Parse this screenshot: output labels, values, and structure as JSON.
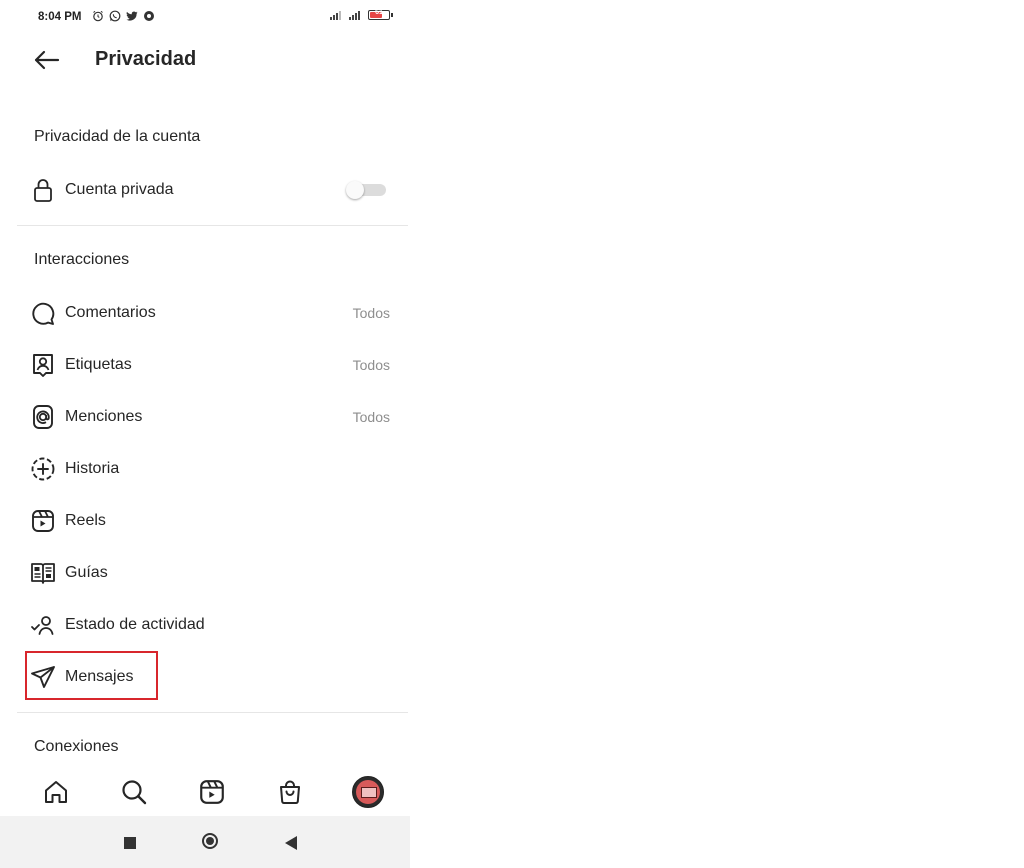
{
  "status_bar": {
    "time": "8:04 PM",
    "battery": "61"
  },
  "header": {
    "title": "Privacidad"
  },
  "account_privacy": {
    "section_title": "Privacidad de la cuenta",
    "private_account": {
      "label": "Cuenta privada",
      "enabled": false
    }
  },
  "interactions": {
    "section_title": "Interacciones",
    "items": [
      {
        "label": "Comentarios",
        "value": "Todos",
        "icon": "comment-icon"
      },
      {
        "label": "Etiquetas",
        "value": "Todos",
        "icon": "tag-person-icon"
      },
      {
        "label": "Menciones",
        "value": "Todos",
        "icon": "at-sign-icon"
      },
      {
        "label": "Historia",
        "value": "",
        "icon": "story-add-icon"
      },
      {
        "label": "Reels",
        "value": "",
        "icon": "reels-icon"
      },
      {
        "label": "Guías",
        "value": "",
        "icon": "guides-icon"
      },
      {
        "label": "Estado de actividad",
        "value": "",
        "icon": "activity-status-icon"
      },
      {
        "label": "Mensajes",
        "value": "",
        "icon": "paper-plane-icon",
        "highlighted": true
      }
    ]
  },
  "connections": {
    "section_title": "Conexiones"
  },
  "bottom_nav": [
    "home-icon",
    "search-icon",
    "reels-icon",
    "shop-icon",
    "profile-avatar"
  ],
  "colors": {
    "highlight": "#d8262c",
    "muted_text": "#8e8e8e",
    "text": "#262626"
  }
}
